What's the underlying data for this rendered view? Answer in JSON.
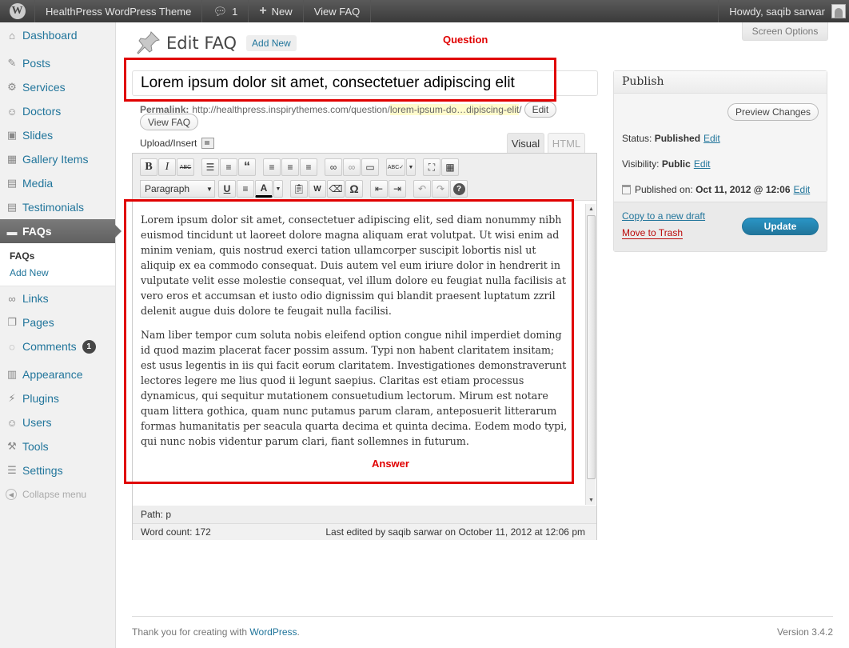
{
  "adminbar": {
    "site_name": "HealthPress WordPress Theme",
    "comments_count": "1",
    "new_label": "New",
    "view_label": "View FAQ",
    "greeting": "Howdy, saqib sarwar"
  },
  "sidebar": {
    "items": [
      {
        "label": "Dashboard",
        "icon": "dashboard-icon"
      },
      {
        "label": "Posts",
        "icon": "posts-icon"
      },
      {
        "label": "Services",
        "icon": "gear-icon"
      },
      {
        "label": "Doctors",
        "icon": "users-icon"
      },
      {
        "label": "Slides",
        "icon": "image-icon"
      },
      {
        "label": "Gallery Items",
        "icon": "grid-icon"
      },
      {
        "label": "Media",
        "icon": "media-icon"
      },
      {
        "label": "Testimonials",
        "icon": "document-icon"
      },
      {
        "label": "FAQs",
        "icon": "faq-icon"
      },
      {
        "label": "Links",
        "icon": "link-icon"
      },
      {
        "label": "Pages",
        "icon": "pages-icon"
      },
      {
        "label": "Comments",
        "icon": "comment-icon"
      },
      {
        "label": "Appearance",
        "icon": "appearance-icon"
      },
      {
        "label": "Plugins",
        "icon": "plugin-icon"
      },
      {
        "label": "Users",
        "icon": "users-icon"
      },
      {
        "label": "Tools",
        "icon": "tools-icon"
      },
      {
        "label": "Settings",
        "icon": "settings-icon"
      }
    ],
    "submenu": [
      "FAQs",
      "Add New"
    ],
    "comments_badge": "1",
    "collapse_label": "Collapse menu"
  },
  "screen_options": "Screen Options",
  "page": {
    "title": "Edit FAQ",
    "add_new": "Add New"
  },
  "annotations": {
    "question": "Question",
    "answer": "Answer"
  },
  "post": {
    "title": "Lorem ipsum dolor sit amet, consectetuer adipiscing elit",
    "permalink_label": "Permalink:",
    "permalink_base": "http://healthpress.inspirythemes.com/question/",
    "permalink_slug": "lorem-ipsum-do…dipiscing-elit",
    "permalink_trail": "/",
    "edit_button": "Edit",
    "view_button": "View FAQ"
  },
  "editor": {
    "upload_label": "Upload/Insert",
    "tab_visual": "Visual",
    "tab_html": "HTML",
    "format_select": "Paragraph",
    "paragraphs": [
      "Lorem ipsum dolor sit amet, consectetuer adipiscing elit, sed diam nonummy nibh euismod tincidunt ut laoreet dolore magna aliquam erat volutpat. Ut wisi enim ad minim veniam, quis nostrud exerci tation ullamcorper suscipit lobortis nisl ut aliquip ex ea commodo consequat. Duis autem vel eum iriure dolor in hendrerit in vulputate velit esse molestie consequat, vel illum dolore eu feugiat nulla facilisis at vero eros et accumsan et iusto odio dignissim qui blandit praesent luptatum zzril delenit augue duis dolore te feugait nulla facilisi.",
      "Nam liber tempor cum soluta nobis eleifend option congue nihil imperdiet doming id quod mazim placerat facer possim assum. Typi non habent claritatem insitam; est usus legentis in iis qui facit eorum claritatem. Investigationes demonstraverunt lectores legere me lius quod ii legunt saepius. Claritas est etiam processus dynamicus, qui sequitur mutationem consuetudium lectorum. Mirum est notare quam littera gothica, quam nunc putamus parum claram, anteposuerit litterarum formas humanitatis per seacula quarta decima et quinta decima. Eodem modo typi, qui nunc nobis videntur parum clari, fiant sollemnes in futurum."
    ],
    "path": "Path: p",
    "word_count": "Word count: 172",
    "last_edited": "Last edited by saqib sarwar on October 11, 2012 at 12:06 pm"
  },
  "publish": {
    "heading": "Publish",
    "preview_button": "Preview Changes",
    "status_label": "Status:",
    "status_value": "Published",
    "visibility_label": "Visibility:",
    "visibility_value": "Public",
    "published_label": "Published on:",
    "published_value": "Oct 11, 2012 @ 12:06",
    "edit_link": "Edit",
    "copy_draft": "Copy to a new draft",
    "trash": "Move to Trash",
    "update_button": "Update"
  },
  "footer": {
    "thanks_prefix": "Thank you for creating with ",
    "thanks_link": "WordPress",
    "thanks_suffix": ".",
    "version": "Version 3.4.2"
  }
}
